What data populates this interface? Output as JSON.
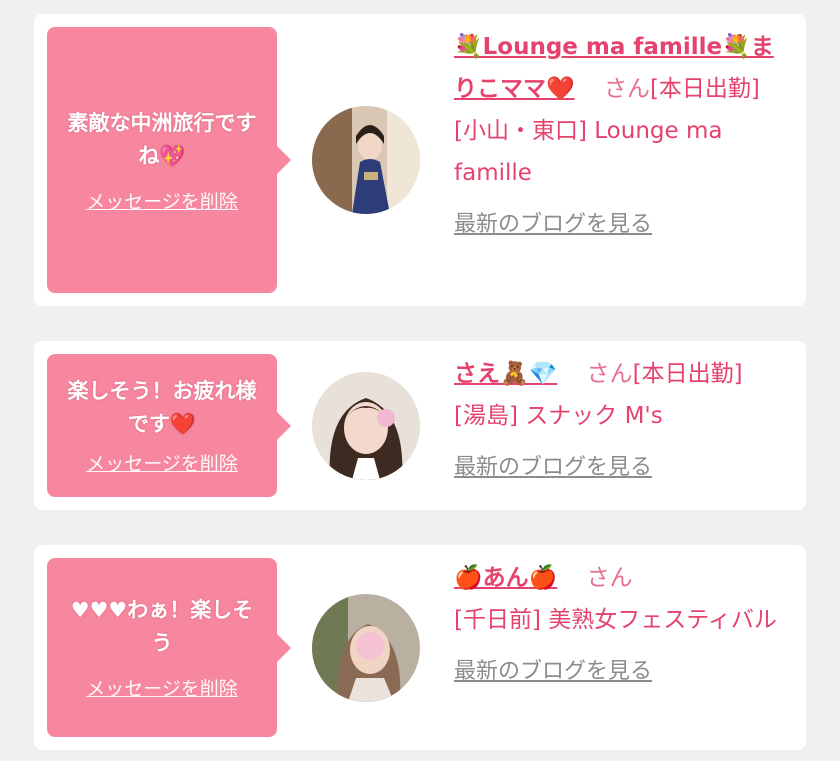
{
  "messages": [
    {
      "text": "素敵な中洲旅行ですね💖",
      "delete_label": "メッセージを削除",
      "name": "💐Lounge ma famille💐まりこママ❤️",
      "honorific": "さん",
      "status": "[本日出勤]",
      "shop": "[小山・東口] Lounge ma famille",
      "blog_label": "最新のブログを見る"
    },
    {
      "text": "楽しそう！お疲れ様です❤️",
      "delete_label": "メッセージを削除",
      "name": "さえ🧸💎",
      "honorific": "さん",
      "status": "[本日出勤]",
      "shop": "[湯島] スナック M's",
      "blog_label": "最新のブログを見る"
    },
    {
      "text": "♥♥♥わぁ！楽しそう",
      "delete_label": "メッセージを削除",
      "name": "🍎あん🍎",
      "honorific": "さん",
      "status": "",
      "shop": "[千日前] 美熟女フェスティバル",
      "blog_label": "最新のブログを見る"
    }
  ]
}
